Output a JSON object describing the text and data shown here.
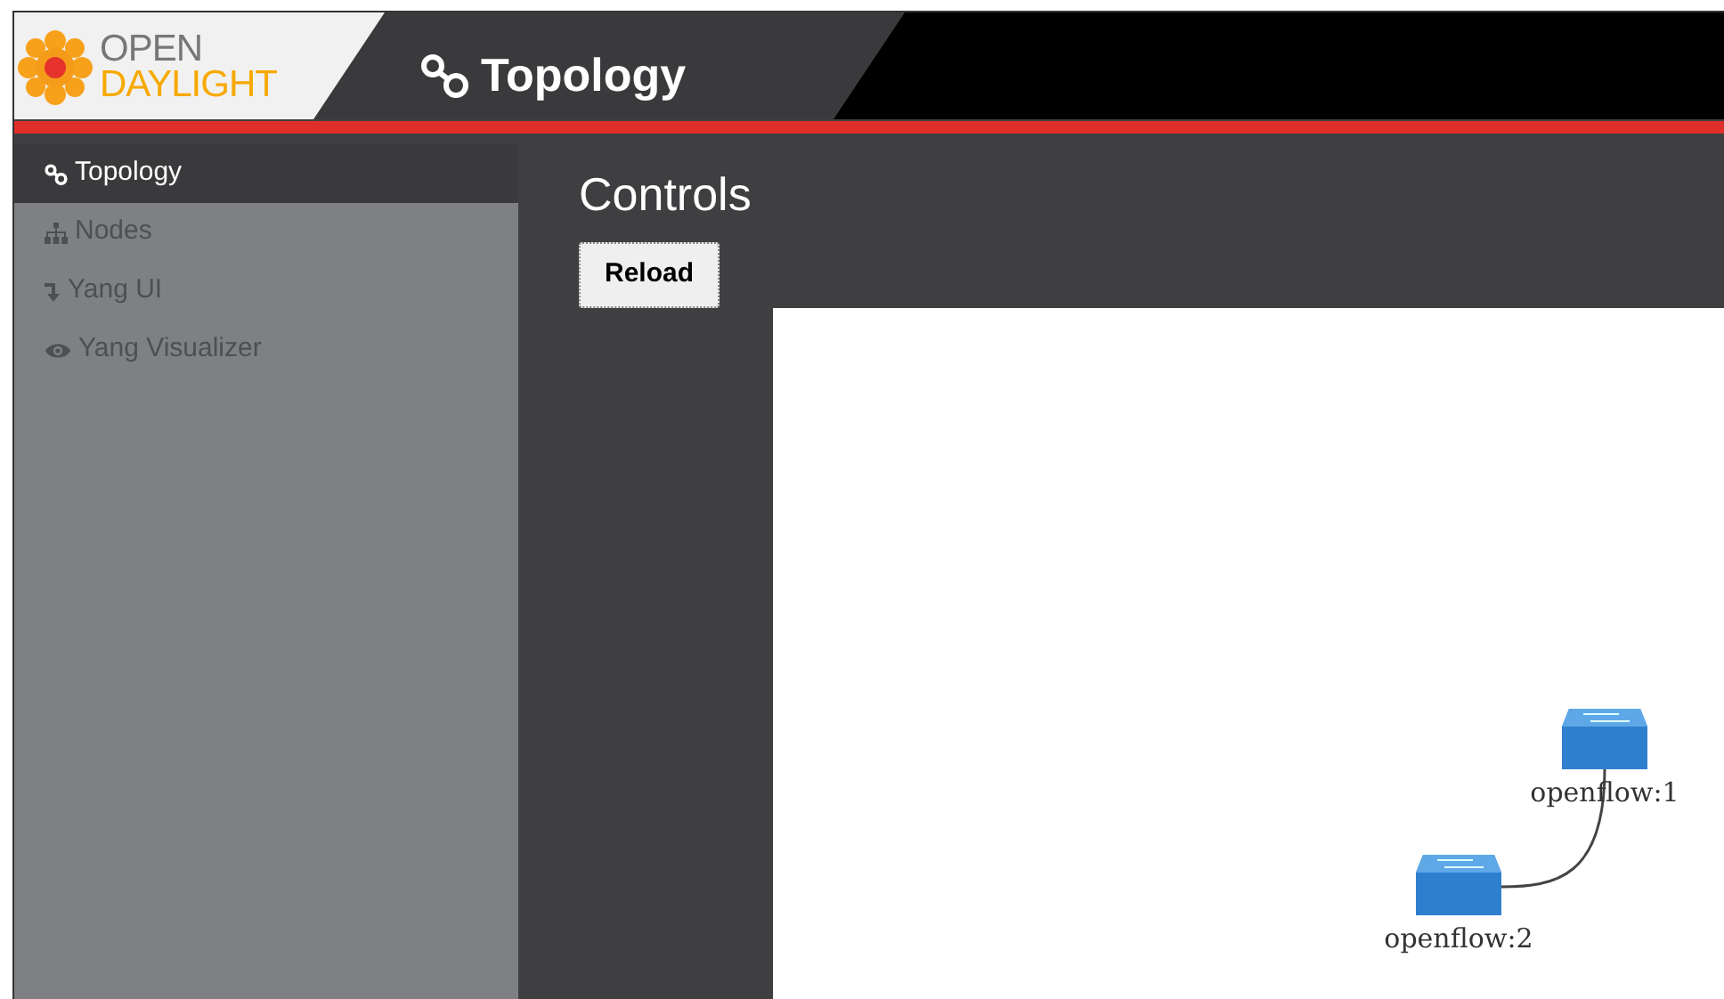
{
  "header": {
    "logo_lines": [
      "OPEN",
      "DAYLIGHT"
    ],
    "title": "Topology"
  },
  "sidebar": {
    "items": [
      {
        "kind": "topology",
        "label": "Topology",
        "selected": true
      },
      {
        "kind": "nodes",
        "label": "Nodes",
        "selected": false
      },
      {
        "kind": "yang-ui",
        "label": "Yang UI",
        "selected": false
      },
      {
        "kind": "visualizer",
        "label": "Yang Visualizer",
        "selected": false
      }
    ]
  },
  "main": {
    "title": "Controls",
    "button": "Reload",
    "topology": {
      "nodes": [
        {
          "label": "openflow:1",
          "linked_to_previous": false
        },
        {
          "label": "openflow:2",
          "linked_to_previous": true
        }
      ]
    }
  }
}
